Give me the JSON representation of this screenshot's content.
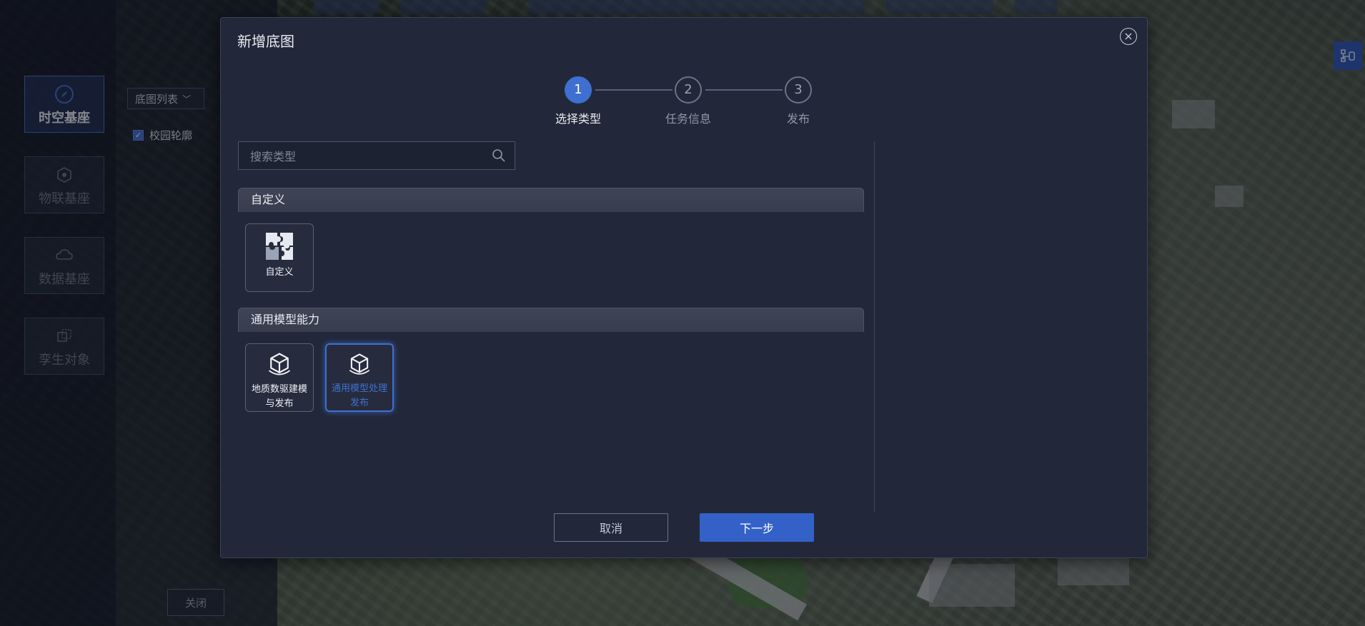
{
  "background": {
    "side_nav": [
      {
        "label": "时空基座",
        "icon": "compass-icon",
        "active": true
      },
      {
        "label": "物联基座",
        "icon": "iot-cube-icon",
        "active": false
      },
      {
        "label": "数据基座",
        "icon": "cloud-data-icon",
        "active": false
      },
      {
        "label": "孪生对象",
        "icon": "twin-cube-icon",
        "active": false
      }
    ],
    "basemap_dropdown": "底图列表",
    "campus_checkbox": {
      "label": "校园轮廓",
      "checked": true
    },
    "close_button": "关闭",
    "float_tool_icon": "tree-structure-icon"
  },
  "modal": {
    "title": "新增底图",
    "steps": [
      {
        "number": "1",
        "label": "选择类型",
        "active": true
      },
      {
        "number": "2",
        "label": "任务信息",
        "active": false
      },
      {
        "number": "3",
        "label": "发布",
        "active": false
      }
    ],
    "search": {
      "placeholder": "搜索类型",
      "value": ""
    },
    "sections": [
      {
        "title": "自定义",
        "items": [
          {
            "label": "自定义",
            "icon": "puzzle-icon",
            "selected": false
          }
        ]
      },
      {
        "title": "通用模型能力",
        "items": [
          {
            "label": "地质数驱建模与发布",
            "icon": "model-cube-icon",
            "selected": false
          },
          {
            "label": "通用模型处理发布",
            "icon": "model-cube-icon",
            "selected": true
          }
        ]
      }
    ],
    "buttons": {
      "cancel": "取消",
      "next": "下一步"
    }
  },
  "colors": {
    "accent": "#3f6fd1",
    "modal_bg": "#22283a",
    "primary_button": "#3361c7"
  }
}
